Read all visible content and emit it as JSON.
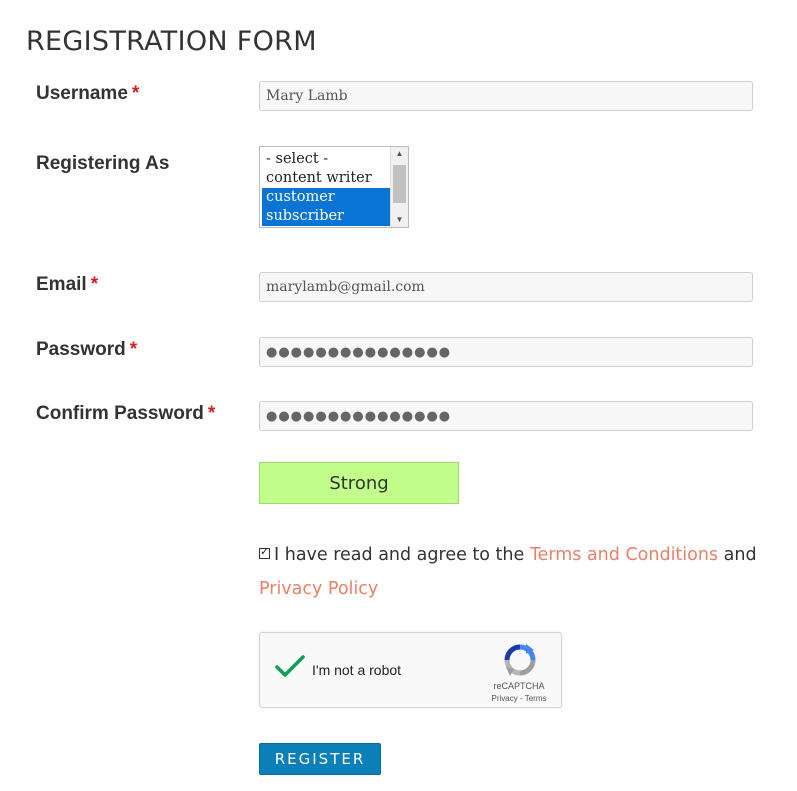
{
  "form": {
    "title": "REGISTRATION FORM",
    "required_mark": "*",
    "username": {
      "label": "Username",
      "value": "Mary Lamb"
    },
    "registering_as": {
      "label": "Registering As",
      "options": [
        "- select -",
        "content writer",
        "customer",
        "subscriber"
      ],
      "selected": [
        "customer",
        "subscriber"
      ]
    },
    "email": {
      "label": "Email",
      "value": "marylamb@gmail.com"
    },
    "password": {
      "label": "Password",
      "value": "●●●●●●●●●●●●●●●"
    },
    "confirm_password": {
      "label": "Confirm Password",
      "value": "●●●●●●●●●●●●●●●"
    },
    "strength": {
      "label": "Strong",
      "color": "#c1ff8a"
    },
    "agree": {
      "checked": true,
      "text_before": "I have read and agree to the",
      "terms_link": "Terms and Conditions",
      "text_middle": "and",
      "privacy_link": "Privacy Policy",
      "link_color": "#e8816a"
    },
    "recaptcha": {
      "label": "I'm not a robot",
      "brand": "reCAPTCHA",
      "privacy": "Privacy",
      "separator": "-",
      "terms": "Terms",
      "checked": true
    },
    "submit": {
      "label": "REGISTER",
      "color": "#0b7fb8"
    }
  }
}
